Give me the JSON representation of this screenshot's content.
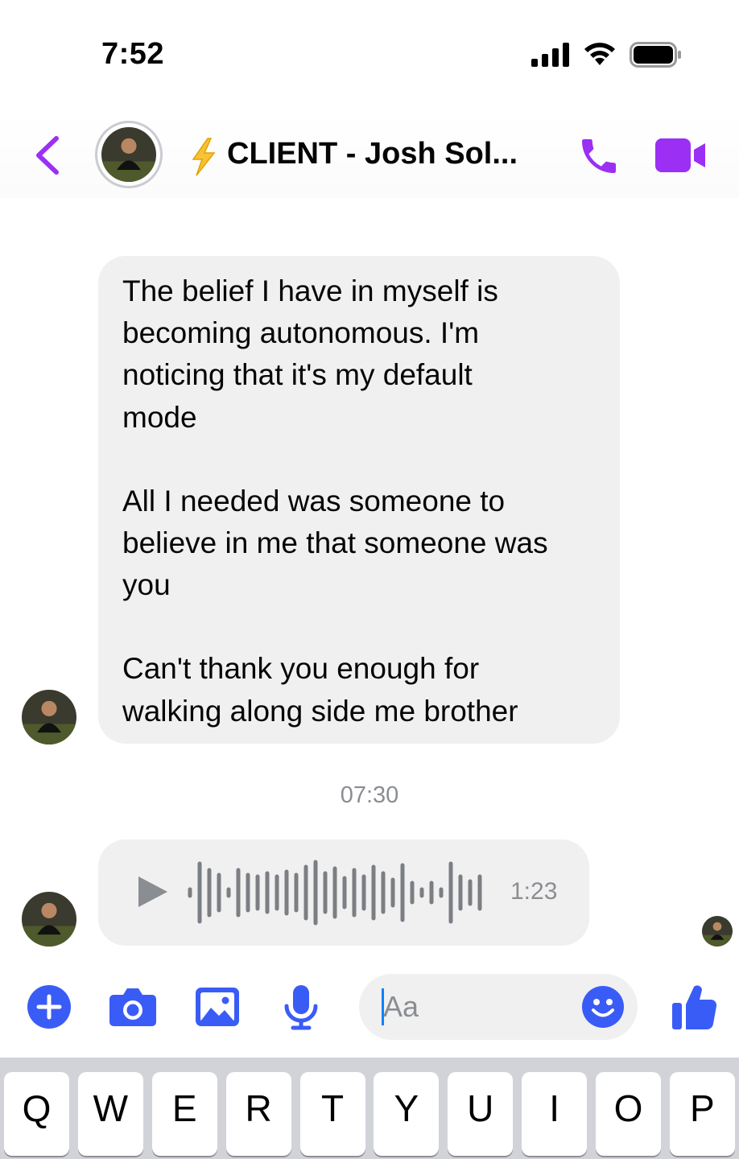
{
  "status_bar": {
    "time": "7:52",
    "icons": [
      "cellular-signal-icon",
      "wifi-icon",
      "battery-icon"
    ]
  },
  "header": {
    "title": "CLIENT - Josh Sol...",
    "title_icon": "lightning-bolt-icon",
    "accent_color": "#9b2ff3"
  },
  "messages": [
    {
      "type": "text",
      "paragraphs": [
        "The belief I have in myself is\nbecoming autonomous. I'm\nnoticing that it's my default\nmode",
        "All I needed was someone to\nbelieve in me  that someone was\nyou",
        "Can't thank you enough for\nwalking along side me brother"
      ]
    },
    {
      "type": "voice",
      "timestamp": "07:30",
      "duration": "1:23"
    }
  ],
  "composer": {
    "placeholder": "Aa",
    "accent_color": "#3a5cf6",
    "buttons": [
      "plus-icon",
      "camera-icon",
      "gallery-icon",
      "microphone-icon",
      "emoji-icon",
      "thumbs-up-icon"
    ]
  },
  "keyboard": {
    "row1": [
      "Q",
      "W",
      "E",
      "R",
      "T",
      "Y",
      "U",
      "I",
      "O",
      "P"
    ]
  },
  "colors": {
    "bubble_bg": "#f0f0f0",
    "meta_text": "#8a8d91"
  }
}
